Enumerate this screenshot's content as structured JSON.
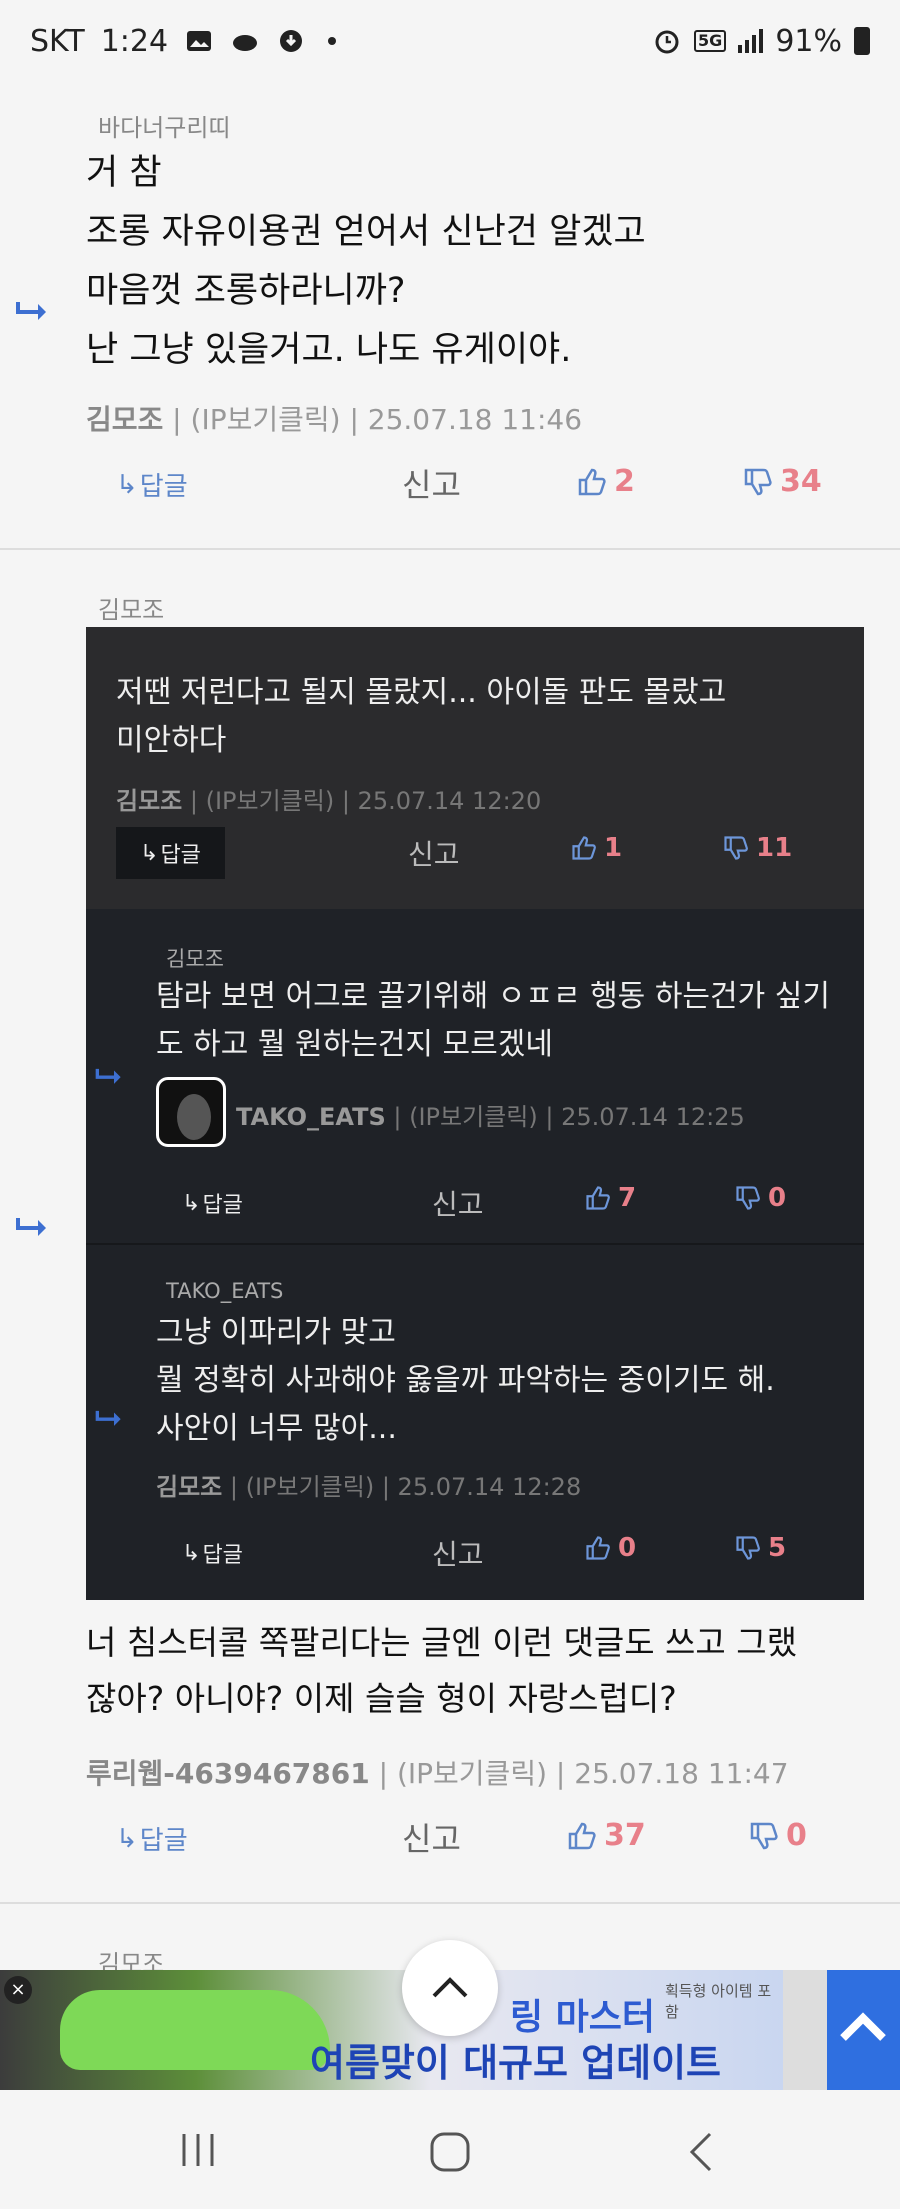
{
  "status": {
    "carrier": "SKT",
    "time": "1:24",
    "network": "5G",
    "battery": "91%"
  },
  "comments": [
    {
      "author_label": "바다너구리띠",
      "body": "거 참\n조롱 자유이용권 얻어서 신난건 알겠고\n마음껏 조롱하라니까?\n난 그냥 있을거고. 나도 유게이야.",
      "meta_author": "김모조",
      "meta_ip": "(IP보기클릭)",
      "meta_date": "25.07.18 11:46",
      "reply_label": "답글",
      "report_label": "신고",
      "likes": "2",
      "dislikes": "34"
    },
    {
      "author_label": "김모조",
      "body": "너 침스터콜 쪽팔리다는 글엔 이런 댓글도 쓰고 그랬\n잖아? 아니야? 이제 슬슬 형이 자랑스럽디?",
      "meta_author": "루리웹-4639467861",
      "meta_ip": "(IP보기클릭)",
      "meta_date": "25.07.18 11:47",
      "reply_label": "답글",
      "report_label": "신고",
      "likes": "37",
      "dislikes": "0"
    }
  ],
  "quoted": [
    {
      "body": "저땐 저런다고 될지 몰랐지... 아이돌 판도 몰랐고\n미안하다",
      "meta_author": "김모조",
      "meta_ip": "(IP보기클릭)",
      "meta_date": "25.07.14 12:20",
      "reply_label": "답글",
      "report_label": "신고",
      "likes": "1",
      "dislikes": "11"
    },
    {
      "author_label": "김모조",
      "body": "탐라 보면 어그로 끌기위해 ㅇㅍㄹ 행동 하는건가 싶기\n도 하고 뭘 원하는건지 모르겠네",
      "meta_author": "TAKO_EATS",
      "meta_ip": "(IP보기클릭)",
      "meta_date": "25.07.14 12:25",
      "reply_label": "답글",
      "report_label": "신고",
      "likes": "7",
      "dislikes": "0"
    },
    {
      "author_label": "TAKO_EATS",
      "body": "그냥 이파리가 맞고\n뭘 정확히 사과해야 옳을까 파악하는 중이기도 해.\n사안이 너무 많아...",
      "meta_author": "김모조",
      "meta_ip": "(IP보기클릭)",
      "meta_date": "25.07.14 12:28",
      "reply_label": "답글",
      "report_label": "신고",
      "likes": "0",
      "dislikes": "5"
    }
  ],
  "next_author": "김모조",
  "ad": {
    "title": "링 마스터",
    "subtitle": "여름맞이 대규모 업데이트",
    "tag": "획득형 아이템 포함"
  },
  "colors": {
    "accent": "#5d86c9",
    "count": "#e8808a",
    "dark_bg": "#1f2227"
  }
}
